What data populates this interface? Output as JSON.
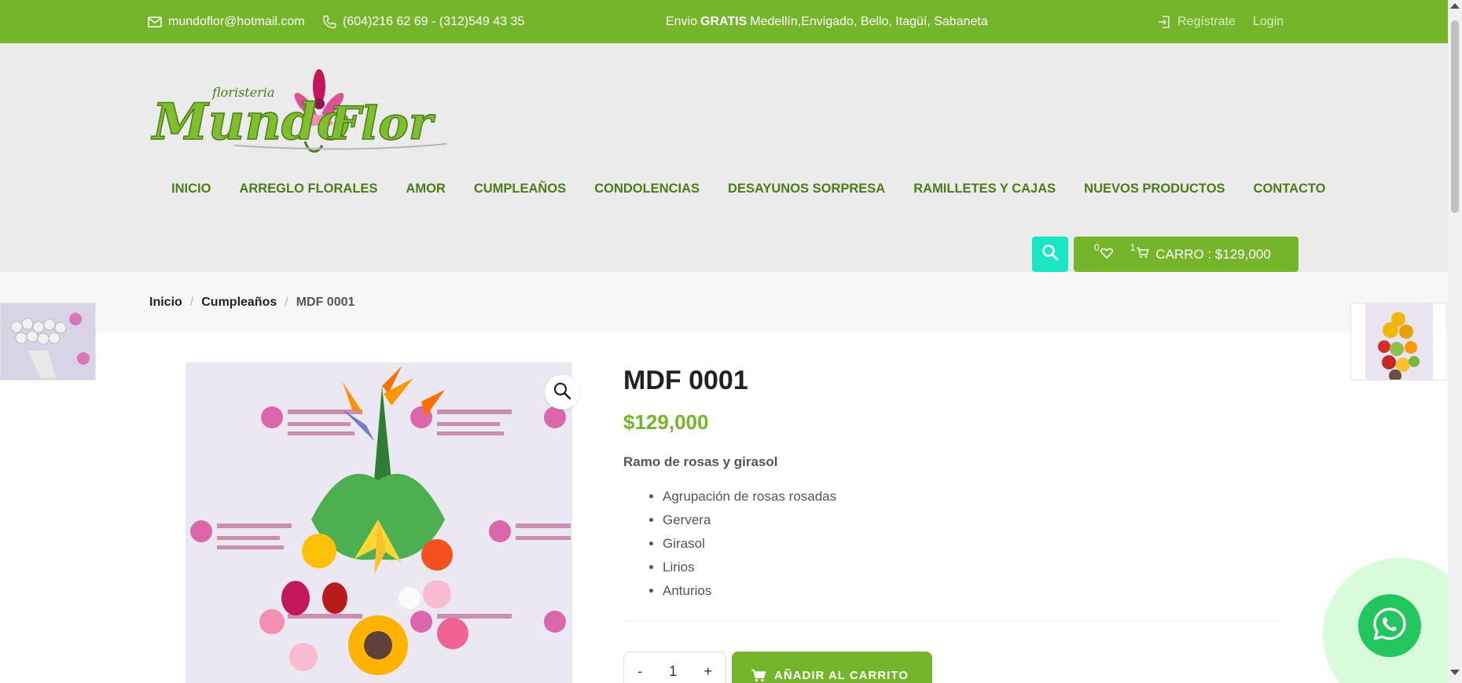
{
  "topbar": {
    "email": "mundoflor@hotmail.com",
    "phones": "(604)216 62 69 - (312)549 43 35",
    "shipping_prefix": "Envio",
    "shipping_bold": "GRATIS",
    "shipping_suffix": "Medellín,Envigado, Bello, Itagüí, Sabaneta",
    "register_label": "Regístrate",
    "login_label": "Login",
    "icons": {
      "email": "envelope-icon",
      "phone": "phone-icon",
      "register": "signin-icon"
    }
  },
  "logo": {
    "script_main": "MundoFlor",
    "script_top": "floristeria"
  },
  "nav": {
    "items": [
      {
        "label": "INICIO"
      },
      {
        "label": "ARREGLO FLORALES"
      },
      {
        "label": "AMOR"
      },
      {
        "label": "CUMPLEAÑOS"
      },
      {
        "label": "CONDOLENCIAS"
      },
      {
        "label": "DESAYUNOS SORPRESA"
      },
      {
        "label": "RAMILLETES Y CAJAS"
      },
      {
        "label": "NUEVOS PRODUCTOS"
      },
      {
        "label": "CONTACTO"
      }
    ]
  },
  "cart": {
    "wishlist_count": "0",
    "cart_count": "1",
    "label": "CARRO : $129,000"
  },
  "breadcrumb": {
    "home": "Inicio",
    "sep": "/",
    "category": "Cumpleaños",
    "current": "MDF 0001"
  },
  "product": {
    "title": "MDF 0001",
    "price": "$129,000",
    "desc_heading": "Ramo de rosas y girasol",
    "features": [
      "Agrupación de rosas rosadas",
      "Gervera",
      "Girasol",
      "Lirios",
      "Anturios"
    ],
    "qty_minus": "-",
    "qty_value": "1",
    "qty_plus": "+",
    "add_to_cart": "AÑADIR AL CARRITO"
  },
  "colors": {
    "brand_green": "#75b52a",
    "nav_green": "#4b7d17",
    "search_teal": "#19e6c3",
    "whatsapp": "#22c55e"
  }
}
